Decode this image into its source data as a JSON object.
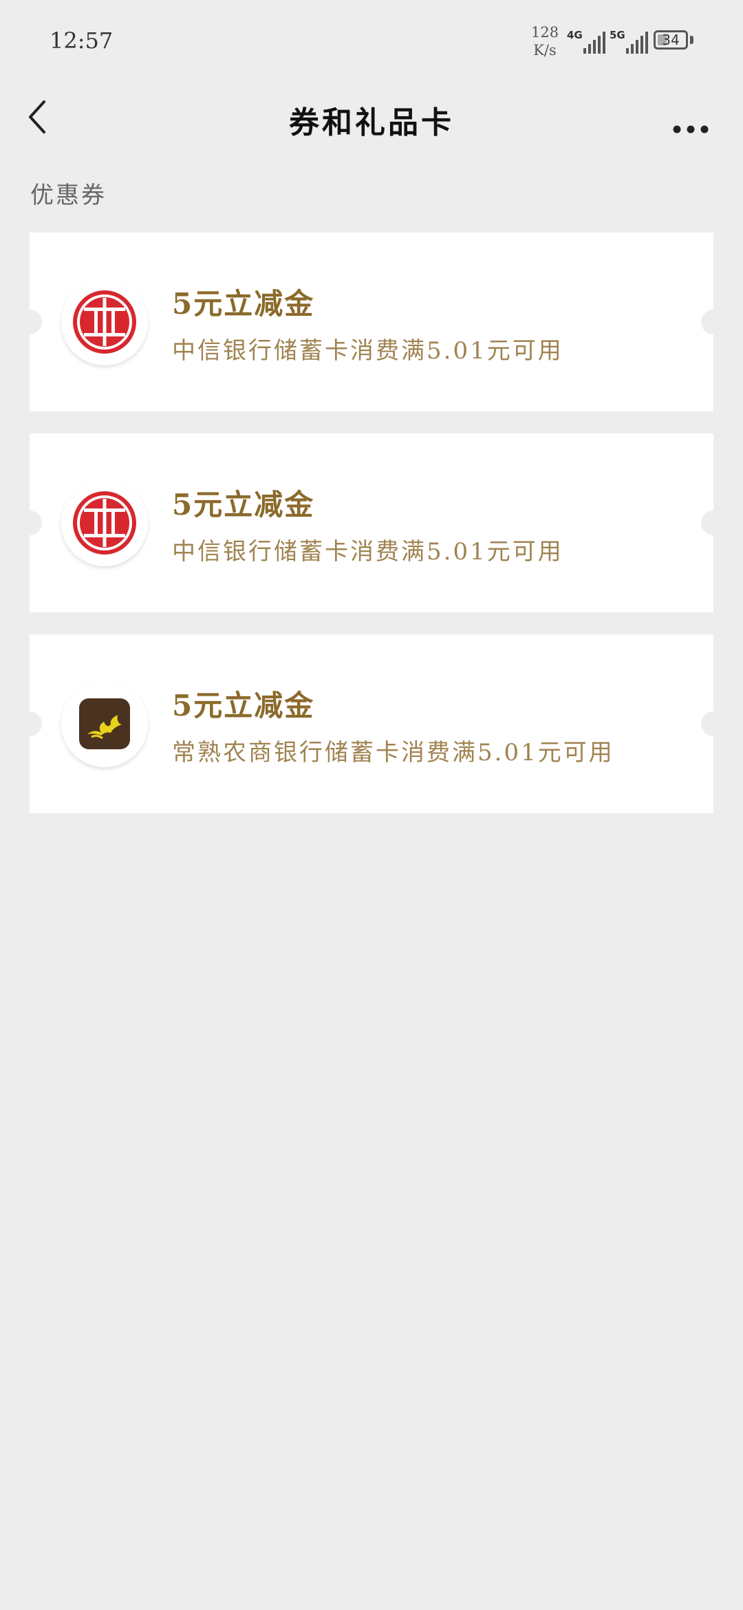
{
  "status_bar": {
    "time": "12:57",
    "net_speed_value": "128",
    "net_speed_unit": "K/s",
    "signal_1_label": "4G",
    "signal_2_label": "5G",
    "battery_level": "34"
  },
  "header": {
    "title": "券和礼品卡",
    "back_icon": "chevron-left-icon",
    "more_icon": "more-dots-icon"
  },
  "section": {
    "label": "优惠券"
  },
  "coupons": [
    {
      "amount": "5元立减金",
      "description": "中信银行储蓄卡消费满5.01元可用",
      "logo_icon": "citic-bank-logo"
    },
    {
      "amount": "5元立减金",
      "description": "中信银行储蓄卡消费满5.01元可用",
      "logo_icon": "citic-bank-logo"
    },
    {
      "amount": "5元立减金",
      "description": "常熟农商银行储蓄卡消费满5.01元可用",
      "logo_icon": "changshu-rural-bank-logo"
    }
  ],
  "colors": {
    "background": "#ededed",
    "card": "#ffffff",
    "amount_gold": "#8b6a2b",
    "desc_gold": "#a08350",
    "citic_red": "#d7282f",
    "changshu_brown": "#4a3220",
    "changshu_yellow": "#e8d21a"
  }
}
